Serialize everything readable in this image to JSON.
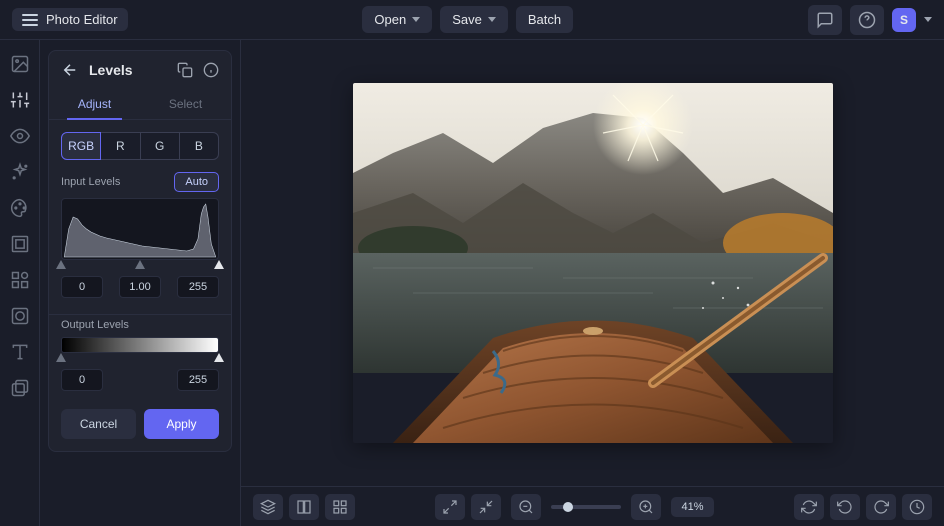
{
  "app": {
    "title": "Photo Editor"
  },
  "header": {
    "open": "Open",
    "save": "Save",
    "batch": "Batch",
    "avatar_initial": "S"
  },
  "panel": {
    "title": "Levels",
    "tabs": {
      "adjust": "Adjust",
      "select": "Select"
    },
    "channels": {
      "rgb": "RGB",
      "r": "R",
      "g": "G",
      "b": "B"
    },
    "input_label": "Input Levels",
    "auto": "Auto",
    "input_values": {
      "black": "0",
      "gamma": "1.00",
      "white": "255"
    },
    "output_label": "Output Levels",
    "output_values": {
      "black": "0",
      "white": "255"
    },
    "cancel": "Cancel",
    "apply": "Apply"
  },
  "bottombar": {
    "zoom": "41%"
  }
}
